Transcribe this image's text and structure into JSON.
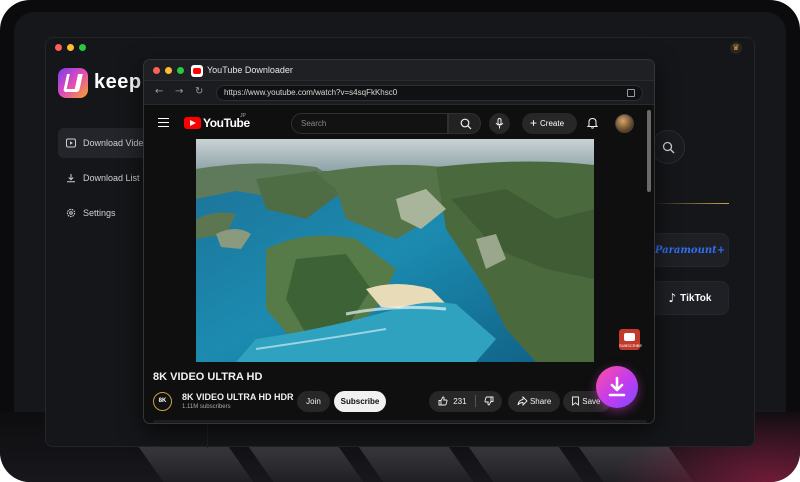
{
  "app": {
    "brand": "keepri",
    "nav": [
      {
        "label": "Download Video",
        "icon": "play-box-icon"
      },
      {
        "label": "Download List",
        "icon": "download-icon"
      },
      {
        "label": "Settings",
        "icon": "gear-icon"
      }
    ],
    "services": [
      {
        "label": "Paramount+",
        "color": "#2f6ff0"
      },
      {
        "label": "TikTok",
        "color": "#ffffff"
      }
    ]
  },
  "browser": {
    "title": "YouTube Downloader",
    "url": "https://www.youtube.com/watch?v=s4sqFkKhsc0"
  },
  "youtube": {
    "logo_text": "YouTube",
    "region": "JP",
    "search_placeholder": "Search",
    "create_label": "Create",
    "video_title": "8K VIDEO ULTRA HD",
    "channel_logo_text": "8K",
    "channel_name": "8K VIDEO ULTRA HD HDR",
    "subscribers": "1.11M subscribers",
    "join_label": "Join",
    "subscribe_label": "Subscribe",
    "likes": "231",
    "share_label": "Share",
    "save_label": "Save",
    "watermark_text": "SUBSCRIBE"
  },
  "colors": {
    "accent_red": "#ff0000",
    "download_gradient_start": "#ff4fa2",
    "download_gradient_end": "#7d4cff",
    "gold": "#c9a347"
  }
}
